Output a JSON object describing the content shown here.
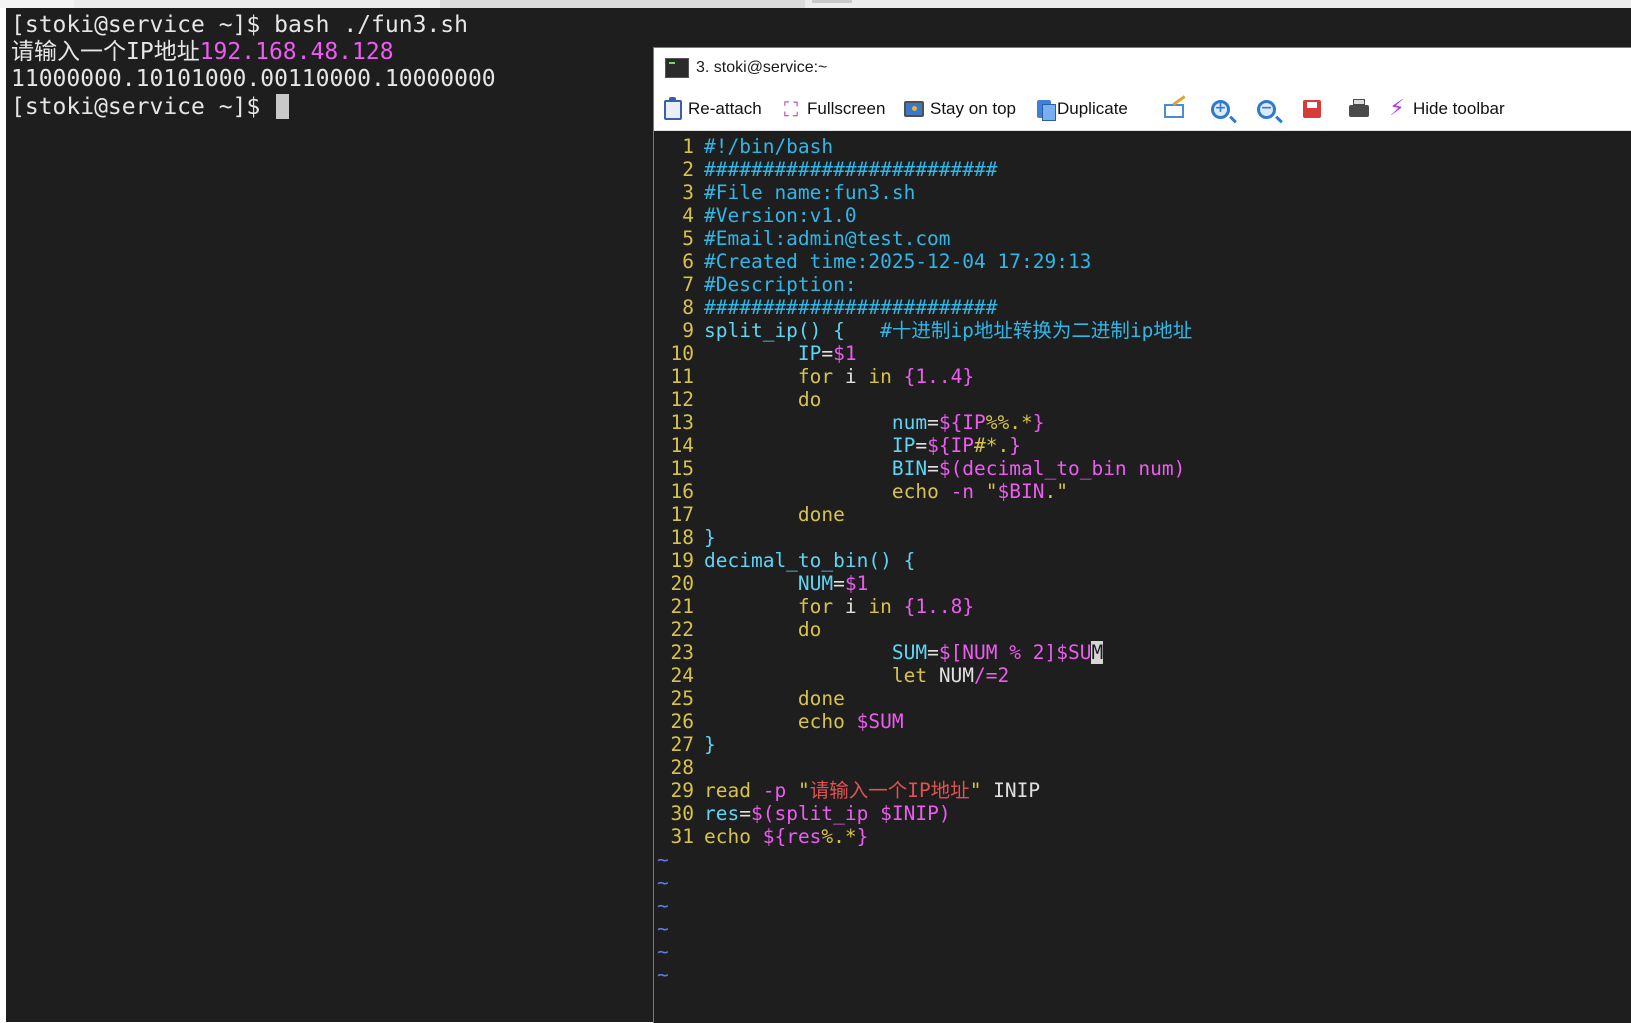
{
  "background_terminal": {
    "lines": [
      {
        "text": "[stoki@service ~]$ bash ./fun3.sh"
      },
      {
        "prompt": "请输入一个IP地址",
        "value": "192.168.48.128"
      },
      {
        "text": "11000000.10101000.00110000.10000000"
      },
      {
        "text": "[stoki@service ~]$ "
      }
    ]
  },
  "window": {
    "title": "3. stoki@service:~",
    "toolbar": {
      "reattach": "Re-attach",
      "fullscreen": "Fullscreen",
      "stay_on_top": "Stay on top",
      "duplicate": "Duplicate",
      "hide_toolbar": "Hide toolbar",
      "icons": [
        "reattach-icon",
        "fullscreen-icon",
        "stay-on-top-icon",
        "duplicate-icon",
        "edit-icon",
        "zoom-in-icon",
        "zoom-out-icon",
        "save-icon",
        "print-icon",
        "lightning-icon"
      ]
    }
  },
  "colors": {
    "comment": "#2fb7e8",
    "keyword": "#d8c34a",
    "variable": "#5cd6f5",
    "special": "#ec5cf0",
    "string": "#e05252",
    "plain": "#e0e0e0",
    "line_number": "#d8c34a",
    "tilde": "#5d7ce6"
  },
  "editor": {
    "lines": [
      {
        "n": "1",
        "segs": [
          [
            "comment",
            "#!/bin/bash"
          ]
        ]
      },
      {
        "n": "2",
        "segs": [
          [
            "comment",
            "#########################"
          ]
        ]
      },
      {
        "n": "3",
        "segs": [
          [
            "comment",
            "#File name:fun3.sh"
          ]
        ]
      },
      {
        "n": "4",
        "segs": [
          [
            "comment",
            "#Version:v1.0"
          ]
        ]
      },
      {
        "n": "5",
        "segs": [
          [
            "comment",
            "#Email:admin@test.com"
          ]
        ]
      },
      {
        "n": "6",
        "segs": [
          [
            "comment",
            "#Created time:2025-12-04 17:29:13"
          ]
        ]
      },
      {
        "n": "7",
        "segs": [
          [
            "comment",
            "#Description:"
          ]
        ]
      },
      {
        "n": "8",
        "segs": [
          [
            "comment",
            "#########################"
          ]
        ]
      },
      {
        "n": "9",
        "segs": [
          [
            "variable",
            "split_ip() {   "
          ],
          [
            "comment",
            "#十进制ip地址转换为二进制ip地址"
          ]
        ]
      },
      {
        "n": "10",
        "segs": [
          [
            "plain",
            "        "
          ],
          [
            "variable",
            "IP"
          ],
          [
            "plain",
            "="
          ],
          [
            "special",
            "$1"
          ]
        ]
      },
      {
        "n": "11",
        "segs": [
          [
            "plain",
            "        "
          ],
          [
            "keyword",
            "for"
          ],
          [
            "plain",
            " i "
          ],
          [
            "keyword",
            "in"
          ],
          [
            "plain",
            " "
          ],
          [
            "special",
            "{1..4}"
          ]
        ]
      },
      {
        "n": "12",
        "segs": [
          [
            "plain",
            "        "
          ],
          [
            "keyword",
            "do"
          ]
        ]
      },
      {
        "n": "13",
        "segs": [
          [
            "plain",
            "                "
          ],
          [
            "variable",
            "num"
          ],
          [
            "plain",
            "="
          ],
          [
            "special",
            "${IP"
          ],
          [
            "keyword",
            "%%.*"
          ],
          [
            "special",
            "}"
          ]
        ]
      },
      {
        "n": "14",
        "segs": [
          [
            "plain",
            "                "
          ],
          [
            "variable",
            "IP"
          ],
          [
            "plain",
            "="
          ],
          [
            "special",
            "${IP"
          ],
          [
            "keyword",
            "#*."
          ],
          [
            "special",
            "}"
          ]
        ]
      },
      {
        "n": "15",
        "segs": [
          [
            "plain",
            "                "
          ],
          [
            "variable",
            "BIN"
          ],
          [
            "plain",
            "="
          ],
          [
            "special",
            "$(decimal_to_bin num)"
          ]
        ]
      },
      {
        "n": "16",
        "segs": [
          [
            "plain",
            "                "
          ],
          [
            "keyword",
            "echo"
          ],
          [
            "plain",
            " "
          ],
          [
            "special",
            "-n"
          ],
          [
            "plain",
            " "
          ],
          [
            "keyword",
            "\""
          ],
          [
            "special",
            "$BIN"
          ],
          [
            "keyword",
            ".\""
          ]
        ]
      },
      {
        "n": "17",
        "segs": [
          [
            "plain",
            "        "
          ],
          [
            "keyword",
            "done"
          ]
        ]
      },
      {
        "n": "18",
        "segs": [
          [
            "variable",
            "}"
          ]
        ]
      },
      {
        "n": "19",
        "segs": [
          [
            "variable",
            "decimal_to_bin() {"
          ]
        ]
      },
      {
        "n": "20",
        "segs": [
          [
            "plain",
            "        "
          ],
          [
            "variable",
            "NUM"
          ],
          [
            "plain",
            "="
          ],
          [
            "special",
            "$1"
          ]
        ]
      },
      {
        "n": "21",
        "segs": [
          [
            "plain",
            "        "
          ],
          [
            "keyword",
            "for"
          ],
          [
            "plain",
            " i "
          ],
          [
            "keyword",
            "in"
          ],
          [
            "plain",
            " "
          ],
          [
            "special",
            "{1..8}"
          ]
        ]
      },
      {
        "n": "22",
        "segs": [
          [
            "plain",
            "        "
          ],
          [
            "keyword",
            "do"
          ]
        ]
      },
      {
        "n": "23",
        "segs": [
          [
            "plain",
            "                "
          ],
          [
            "variable",
            "SUM"
          ],
          [
            "plain",
            "="
          ],
          [
            "special",
            "$[NUM % 2]$SU"
          ],
          [
            "cursor",
            "M"
          ]
        ]
      },
      {
        "n": "24",
        "segs": [
          [
            "plain",
            "                "
          ],
          [
            "keyword",
            "let"
          ],
          [
            "plain",
            " NUM"
          ],
          [
            "special",
            "/=2"
          ]
        ]
      },
      {
        "n": "25",
        "segs": [
          [
            "plain",
            "        "
          ],
          [
            "keyword",
            "done"
          ]
        ]
      },
      {
        "n": "26",
        "segs": [
          [
            "plain",
            "        "
          ],
          [
            "keyword",
            "echo"
          ],
          [
            "plain",
            " "
          ],
          [
            "special",
            "$SUM"
          ]
        ]
      },
      {
        "n": "27",
        "segs": [
          [
            "variable",
            "}"
          ]
        ]
      },
      {
        "n": "28",
        "segs": []
      },
      {
        "n": "29",
        "segs": [
          [
            "keyword",
            "read"
          ],
          [
            "plain",
            " "
          ],
          [
            "special",
            "-p"
          ],
          [
            "plain",
            " "
          ],
          [
            "keyword",
            "\""
          ],
          [
            "string",
            "请输入一个IP地址"
          ],
          [
            "keyword",
            "\""
          ],
          [
            "plain",
            " INIP"
          ]
        ]
      },
      {
        "n": "30",
        "segs": [
          [
            "variable",
            "res"
          ],
          [
            "plain",
            "="
          ],
          [
            "special",
            "$(split_ip $INIP)"
          ]
        ]
      },
      {
        "n": "31",
        "segs": [
          [
            "keyword",
            "echo"
          ],
          [
            "plain",
            " "
          ],
          [
            "special",
            "${res"
          ],
          [
            "keyword",
            "%.*"
          ],
          [
            "special",
            "}"
          ]
        ]
      }
    ],
    "tildes": [
      "~",
      "~",
      "~",
      "~",
      "~",
      "~"
    ]
  }
}
